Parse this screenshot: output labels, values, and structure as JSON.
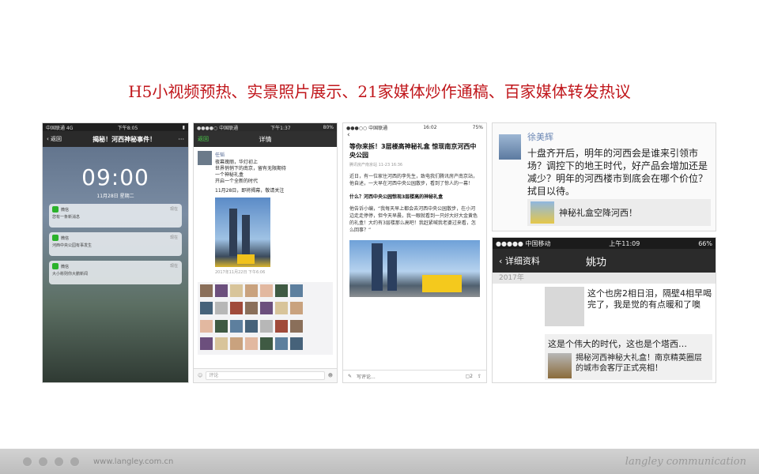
{
  "slide_title": "H5小视频预热、实景照片展示、21家媒体炒作通稿、百家媒体转发热议",
  "shot1": {
    "carrier": "中国联通 4G",
    "time": "下午8:05",
    "back": "返回",
    "title": "揭秘！河西神秘事件！",
    "clock": "09:00",
    "date": "11月28日 星期二",
    "notifications": [
      {
        "app": "微信",
        "time": "现在",
        "msg": "您有一条新消息"
      },
      {
        "app": "微信",
        "time": "现在",
        "msg": "河西中央公园有事发生"
      },
      {
        "app": "微信",
        "time": "现在",
        "msg": "大小彬则你大鹏新闻"
      }
    ]
  },
  "shot2": {
    "carrier": "●●●●○ 中国联通",
    "time": "下午1:37",
    "battery": "80%",
    "back": "返回",
    "title": "详情",
    "name": "任韬",
    "text": "夜幕瑰丽，华灯初上\n世界悄悄下的南京，留有无限期待\n一个神秘礼盒\n开启一个全新的时代",
    "date_line": "11月28日，即将揭幕，敬请关注",
    "meta": "2017年11月22日 下午6:06",
    "comment_placeholder": "评论"
  },
  "shot3": {
    "carrier": "●●●○○ 中国联通",
    "time": "16:02",
    "battery": "75%",
    "title": "等你来拆！3层楼高神秘礼盒 惊现南京河西中央公园",
    "meta": "腾讯房产南京站 11-23 16:36",
    "p1": "近日，有一位家住河西的李先生，致电我们腾讯房产南京站，他自述，一大早在河西中央公园散步，看到了惊人的一幕！",
    "sub": "什么？河西中央公园惊现3层楼高的神秘礼盒",
    "p2": "他告诉小编，“我每天早上都会去河西中央公园散步，在小河边走走停停，但今天早晨，我一眼就看到一只好大好大金黄色的礼盒！大约有3层楼那么高吧！我赶紧喊我老婆过来看，怎么回事？”",
    "write_comment": "写评论...",
    "comments_count": "2"
  },
  "shot4": {
    "user": "徐美辉",
    "text": "十盘齐开后，明年的河西会是谁来引领市场？调控下的地王时代，好产品会增加还是减少？明年的河西楼市到底会在哪个价位？拭目以待。",
    "link": "神秘礼盒空降河西！"
  },
  "shot5": {
    "carrier": "●●●●● 中国移动",
    "time": "上午11:09",
    "battery": "66%",
    "back": "详细资料",
    "title": "姚功",
    "year": "2017年",
    "row1": "这个也房2相日泪，隔壁4相早喝完了，我是觉的有点暖和了噢",
    "row2_head": "这是个伟大的时代，这也是个塔西…",
    "row2_body": "揭秘河西神秘大礼盒！南京精英圈层的城市会客厅正式亮相！"
  },
  "footer": {
    "url": "www.langley.com.cn",
    "brand": "langley communication"
  }
}
